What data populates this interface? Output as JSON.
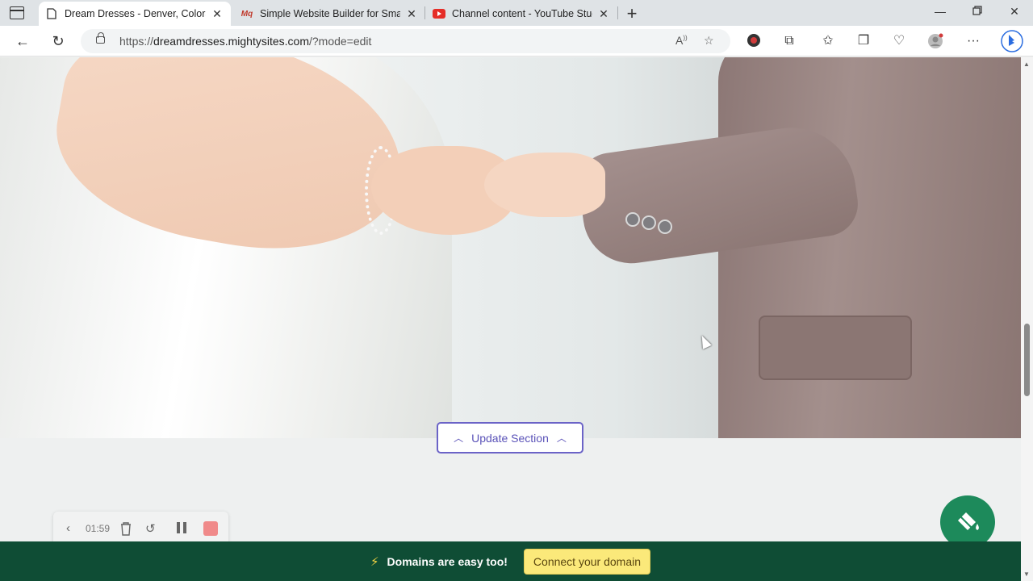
{
  "browser": {
    "tabs": [
      {
        "title": "Dream Dresses - Denver, Colorado",
        "active": true,
        "favicon": "page-icon"
      },
      {
        "title": "Simple Website Builder for Small",
        "active": false,
        "favicon": "mighty-logo"
      },
      {
        "title": "Channel content - YouTube Studio",
        "active": false,
        "favicon": "youtube-logo"
      }
    ],
    "favicon_text": "Mq",
    "url_prefix": "https://",
    "url_host": "dreamdresses.mightysites.com",
    "url_path": "/?mode=edit"
  },
  "editor": {
    "update_section_label": "Update Section"
  },
  "banner": {
    "text": "Domains are easy too!",
    "button_label": "Connect your domain"
  },
  "recorder": {
    "time": "01:59"
  },
  "colors": {
    "banner_bg": "#0f4d35",
    "accent": "#6b63c7",
    "connect_btn": "#fbe97a",
    "fab": "#1d8a5b",
    "stop": "#f08a8a"
  }
}
